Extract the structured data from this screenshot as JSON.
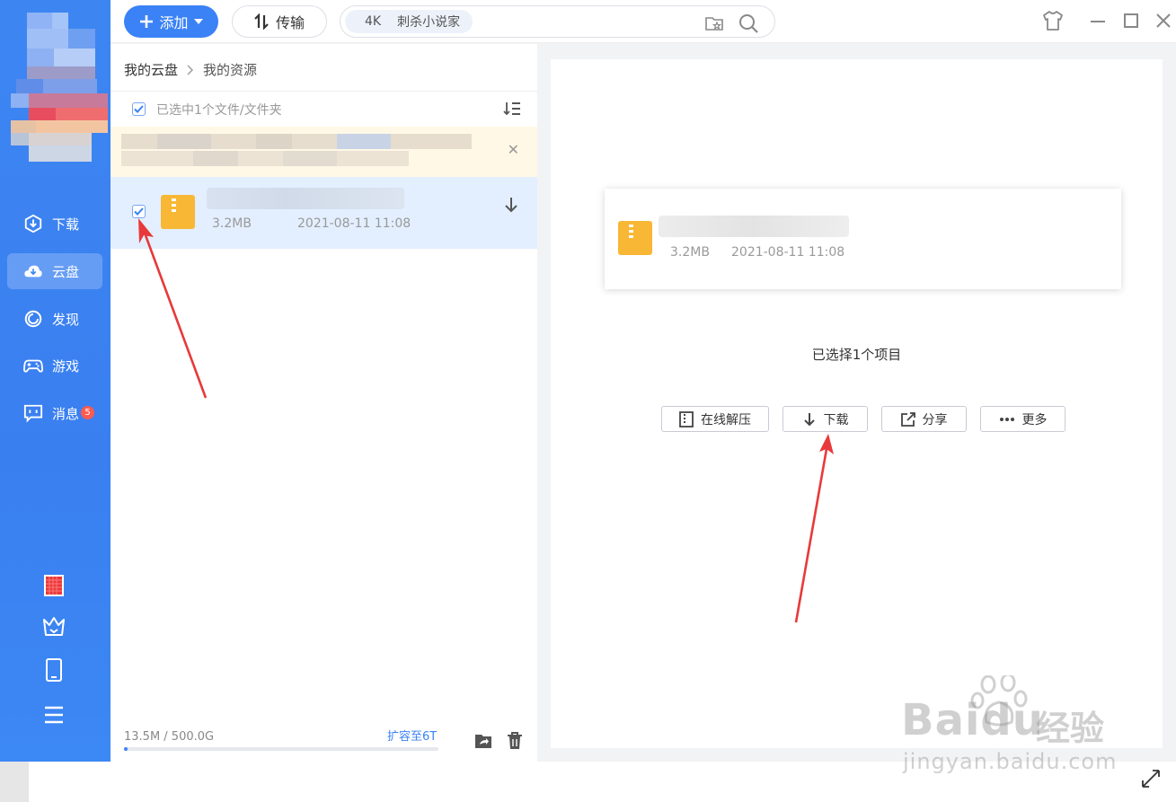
{
  "topbar": {
    "add_label": "添加",
    "transfer_label": "传输",
    "search_chip_quality": "4K",
    "search_chip_text": "刺杀小说家"
  },
  "sidebar": {
    "items": [
      {
        "label": "下载",
        "icon": "download-icon"
      },
      {
        "label": "云盘",
        "icon": "cloud-icon",
        "active": true
      },
      {
        "label": "发现",
        "icon": "discover-icon"
      },
      {
        "label": "游戏",
        "icon": "gamepad-icon"
      },
      {
        "label": "消息",
        "icon": "message-icon",
        "badge": "5"
      }
    ],
    "tools": [
      "gift-icon",
      "crown-icon",
      "phone-icon",
      "menu-icon"
    ]
  },
  "file_panel": {
    "breadcrumb_root": "我的云盘",
    "breadcrumb_current": "我的资源",
    "selection_text": "已选中1个文件/文件夹",
    "file": {
      "size": "3.2MB",
      "date": "2021-08-11 11:08"
    },
    "storage_text": "13.5M / 500.0G",
    "storage_used_fraction": 0.01,
    "expand_label": "扩容至6T"
  },
  "detail": {
    "file": {
      "size": "3.2MB",
      "date": "2021-08-11 11:08"
    },
    "selected_count_text": "已选择1个项目",
    "actions": [
      "在线解压",
      "下载",
      "分享",
      "更多"
    ]
  },
  "watermark": {
    "brand": "Baidu",
    "cn": "经验",
    "url": "jingyan.baidu.com"
  },
  "colors": {
    "accent": "#3b82f6",
    "sidebar": "#3d86f2",
    "arrow": "#e8393a",
    "zip": "#f8b735"
  }
}
